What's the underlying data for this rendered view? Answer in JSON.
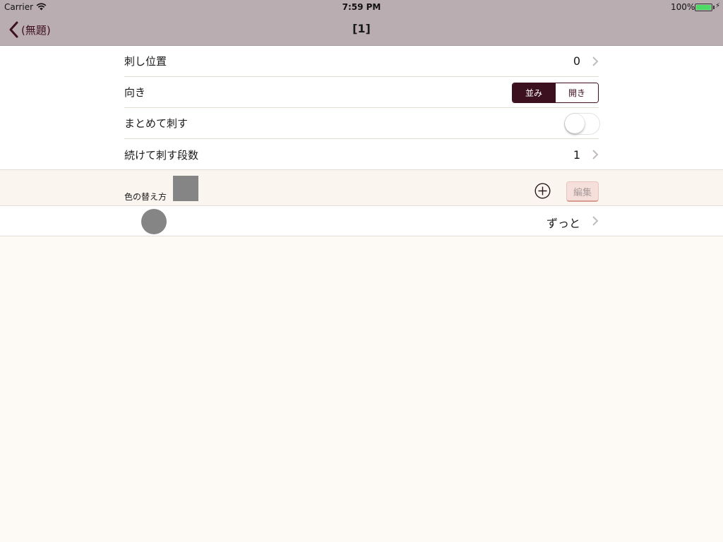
{
  "status_bar": {
    "carrier": "Carrier",
    "time": "7:59 PM",
    "battery": "100%",
    "battery_color": "#4cd964"
  },
  "nav": {
    "back_label": "(無題)",
    "title": "[1]"
  },
  "settings": {
    "stitch_position": {
      "label": "刺し位置",
      "value": "0"
    },
    "direction": {
      "label": "向き",
      "options": [
        "並み",
        "開き"
      ],
      "selected": "並み"
    },
    "batch_stitch": {
      "label": "まとめて刺す",
      "on": false
    },
    "consecutive_rows": {
      "label": "続けて刺す段数",
      "value": "1"
    }
  },
  "color_section": {
    "header_label": "色の替え方",
    "swatch_color": "#858585",
    "edit_label": "編集",
    "rows": [
      {
        "dot_color": "#858585",
        "value": "ずっと"
      }
    ]
  },
  "theme": {
    "accent": "#3d1020",
    "nav_bg": "#baadb1",
    "page_bg": "#fdf9f4"
  },
  "icons": {
    "back": "chevron-left-icon",
    "disclosure": "chevron-right-icon",
    "add": "plus-circle-icon",
    "wifi": "wifi-icon",
    "battery": "battery-icon",
    "charging": "bolt-icon"
  }
}
